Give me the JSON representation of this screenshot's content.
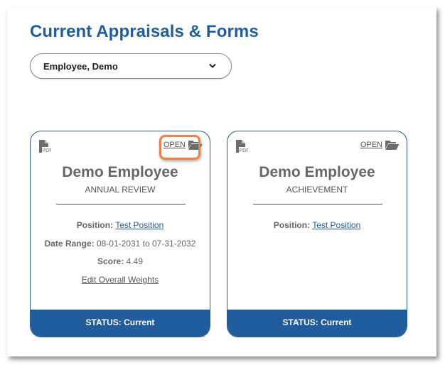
{
  "page": {
    "title": "Current Appraisals & Forms"
  },
  "employee_select": {
    "value": "Employee, Demo",
    "icon": "chevron-down-icon"
  },
  "colors": {
    "brand_blue": "#215d9c",
    "highlight_orange": "#ef7f45"
  },
  "cards": [
    {
      "pdf_icon": "pdf-file-icon",
      "open_label": "OPEN",
      "open_icon": "folder-open-icon",
      "employee_name": "Demo Employee",
      "form_type": "ANNUAL REVIEW",
      "position_label": "Position:",
      "position_value": "Test Position",
      "date_range_label": "Date Range:",
      "date_range_value": "08-01-2031 to 07-31-2032",
      "score_label": "Score:",
      "score_value": "4.49",
      "edit_weights_label": "Edit Overall Weights",
      "status": "STATUS: Current",
      "open_highlighted": true
    },
    {
      "pdf_icon": "pdf-file-icon",
      "open_label": "OPEN",
      "open_icon": "folder-open-icon",
      "employee_name": "Demo Employee",
      "form_type": "ACHIEVEMENT",
      "position_label": "Position:",
      "position_value": "Test Position",
      "status": "STATUS: Current",
      "open_highlighted": false
    }
  ]
}
